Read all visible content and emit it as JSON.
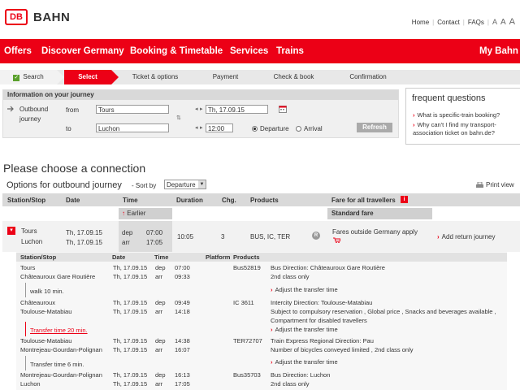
{
  "header": {
    "logo": "DB",
    "brand": "BAHN",
    "links": [
      "Home",
      "Contact",
      "FAQs"
    ],
    "font_sizes": [
      "A",
      "A",
      "A"
    ]
  },
  "nav": {
    "items": [
      "Offers",
      "Discover Germany",
      "Booking & Timetable",
      "Services",
      "Trains"
    ],
    "my_bahn": "My Bahn"
  },
  "steps": [
    "Search",
    "Select",
    "Ticket & options",
    "Payment",
    "Check & book",
    "Confirmation"
  ],
  "journey_info": {
    "heading": "Information on your journey",
    "section_label_1": "Outbound",
    "section_label_2": "journey",
    "from_label": "from",
    "from_value": "Tours",
    "to_label": "to",
    "to_value": "Luchon",
    "date_value": "Th, 17.09.15",
    "time_value": "12:00",
    "departure_label": "Departure",
    "arrival_label": "Arrival",
    "refresh_label": "Refresh"
  },
  "faq": {
    "title": "frequent questions",
    "q1": "What is specific-train booking?",
    "q2": "Why can't I find my transport-association ticket on bahn.de?"
  },
  "results": {
    "heading": "Please choose a connection",
    "subheading": "Options for outbound journey",
    "sort_label": "Sort by",
    "sort_value": "Departure",
    "print_label": "Print view",
    "columns": {
      "station": "Station/Stop",
      "date": "Date",
      "time": "Time",
      "duration": "Duration",
      "changes": "Chg.",
      "products": "Products",
      "fare": "Fare for all travellers"
    },
    "earlier": "Earlier",
    "standard_fare": "Standard fare",
    "connection": {
      "from": "Tours",
      "to": "Luchon",
      "date_dep": "Th, 17.09.15",
      "date_arr": "Th, 17.09.15",
      "dep_label": "dep",
      "arr_label": "arr",
      "dep_time": "07:00",
      "arr_time": "17:05",
      "duration": "10:05",
      "changes": "3",
      "products": "BUS, IC, TER",
      "badge": "R",
      "fare_note": "Fares outside Germany apply",
      "add_return": "Add return journey"
    }
  },
  "details": {
    "columns": [
      "Station/Stop",
      "Date",
      "Time",
      "Platform",
      "Products"
    ],
    "legs": [
      {
        "from": "Tours",
        "to": "Châteauroux Gare Routière",
        "date1": "Th, 17.09.15",
        "date2": "Th, 17.09.15",
        "dep": "dep",
        "arr": "arr",
        "t1": "07:00",
        "t2": "09:33",
        "product": "Bus52819",
        "info1": "Bus Direction: Châteauroux Gare Routière",
        "info2": "2nd class only"
      },
      {
        "from": "Châteauroux",
        "to": "Toulouse-Matabiau",
        "date1": "Th, 17.09.15",
        "date2": "Th, 17.09.15",
        "dep": "dep",
        "arr": "arr",
        "t1": "09:49",
        "t2": "14:18",
        "product": "IC 3611",
        "info1": "Intercity Direction: Toulouse-Matabiau",
        "info2": "Subject to compulsory reservation , Global price , Snacks and beverages available ,",
        "info3": "Compartment for disabled travellers"
      },
      {
        "from": "Toulouse-Matabiau",
        "to": "Montrejeau-Gourdan-Polignan",
        "date1": "Th, 17.09.15",
        "date2": "Th, 17.09.15",
        "dep": "dep",
        "arr": "arr",
        "t1": "14:38",
        "t2": "16:07",
        "product": "TER72707",
        "info1": "Train Express Regional Direction: Pau",
        "info2": "Number of bicycles conveyed limited , 2nd class only"
      },
      {
        "from": "Montrejeau-Gourdan-Polignan",
        "to": "Luchon",
        "date1": "Th, 17.09.15",
        "date2": "Th, 17.09.15",
        "dep": "dep",
        "arr": "arr",
        "t1": "16:13",
        "t2": "17:05",
        "product": "Bus35703",
        "info1": "Bus Direction: Luchon",
        "info2": "2nd class only"
      }
    ],
    "walk": "walk  10 min.",
    "transfer_20": "Transfer time 20 min.",
    "transfer_6": "Transfer time 6 min.",
    "adjust": "Adjust the transfer time"
  }
}
